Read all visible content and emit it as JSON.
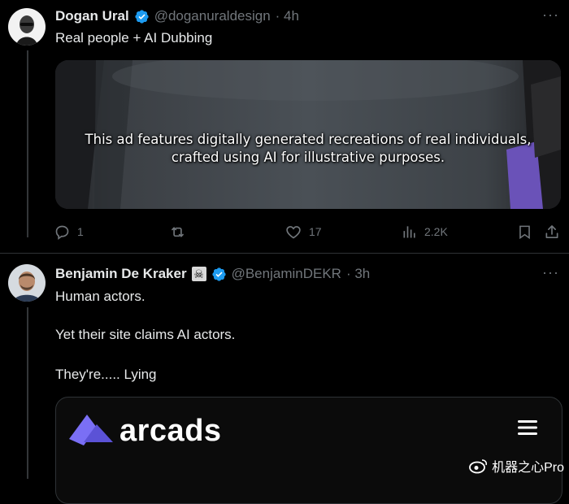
{
  "tweet1": {
    "name": "Dogan Ural",
    "handle": "@doganuraldesign",
    "time": "· 4h",
    "text": "Real people + AI Dubbing",
    "media_caption": {
      "line1": "This ad features digitally generated recreations of real individuals,",
      "line2": "crafted using AI for illustrative purposes."
    },
    "actions": {
      "reply_count": "1",
      "retweet_count": "",
      "like_count": "17",
      "views_count": "2.2K"
    },
    "icons": [
      "verified-badge-icon",
      "reply-icon",
      "retweet-icon",
      "heart-icon",
      "views-icon",
      "bookmark-icon",
      "share-icon",
      "more-icon"
    ]
  },
  "tweet2": {
    "name": "Benjamin De Kraker",
    "name_emoji": "☠",
    "handle": "@BenjaminDEKR",
    "time": "· 3h",
    "lines": [
      "Human actors.",
      "Yet their site claims AI actors.",
      "They're..... Lying"
    ],
    "card": {
      "brand": "arcads",
      "icons": [
        "arcads-logo-icon",
        "hamburger-menu-icon"
      ]
    }
  },
  "watermark": {
    "text": "机器之心Pro"
  },
  "colors": {
    "background": "#000000",
    "text_primary": "#e7e9ea",
    "text_secondary": "#71767b",
    "verified_blue": "#1d9bf0",
    "arcads_purple": "#6e63f2"
  }
}
